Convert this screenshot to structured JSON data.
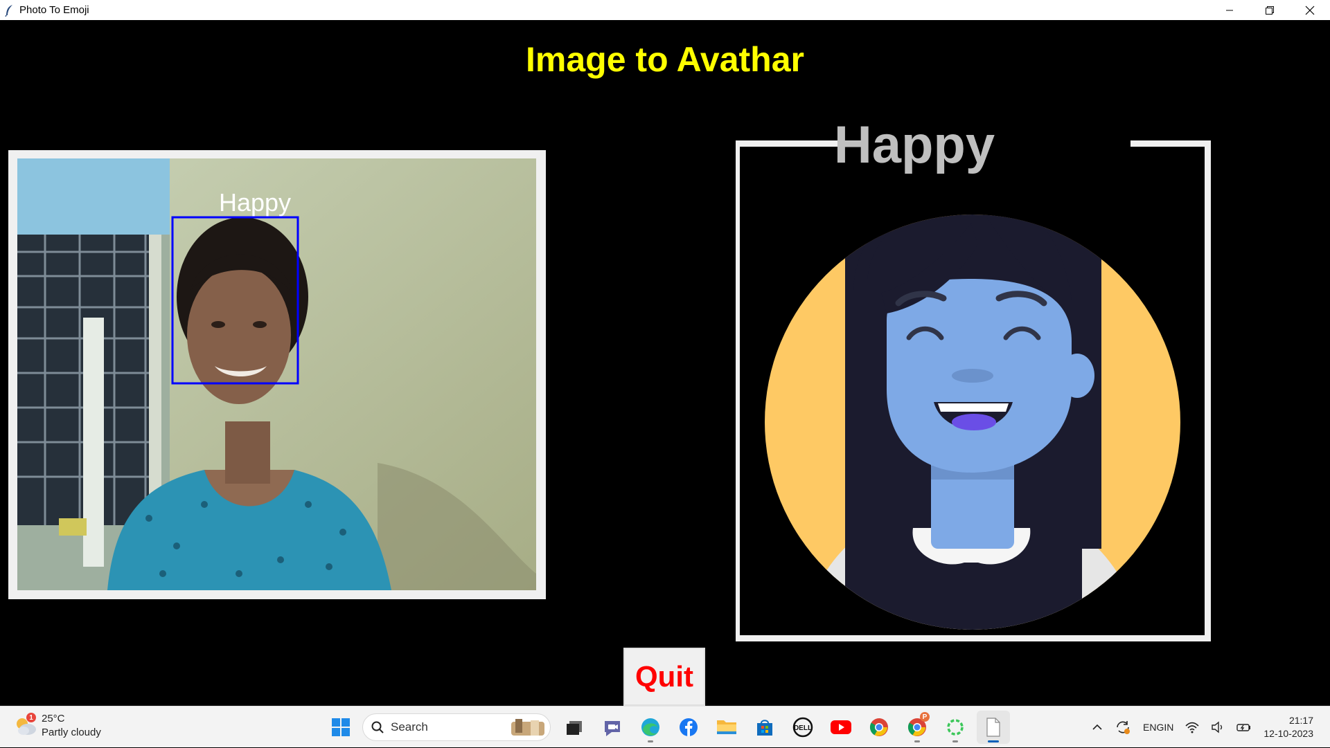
{
  "window": {
    "title": "Photo To Emoji",
    "minimize_label": "",
    "restore_label": "",
    "close_label": ""
  },
  "app": {
    "heading": "Image to Avathar",
    "camera": {
      "emotion_label": "Happy"
    },
    "avatar": {
      "emotion_label": "Happy"
    },
    "quit_label": "Quit"
  },
  "taskbar": {
    "weather": {
      "temperature": "25°C",
      "condition": "Partly cloudy",
      "badge": "1"
    },
    "search_placeholder": "Search",
    "apps": [
      "start-icon",
      "search",
      "task-view-icon",
      "chat-icon",
      "edge-icon",
      "facebook-icon",
      "file-explorer-icon",
      "store-icon",
      "dell-icon",
      "youtube-icon",
      "chrome-icon",
      "chrome-profile-icon",
      "loading-app-icon",
      "document-icon"
    ],
    "chrome_profile_badge": "P",
    "tray": {
      "language_top": "ENG",
      "language_bottom": "IN",
      "time": "21:17",
      "date": "12-10-2023"
    }
  },
  "colors": {
    "heading": "#ffff00",
    "quit_text": "#ff0000",
    "face_box": "#0000ff",
    "avatar_background": "#fec964",
    "avatar_skin": "#7ea9e6"
  }
}
